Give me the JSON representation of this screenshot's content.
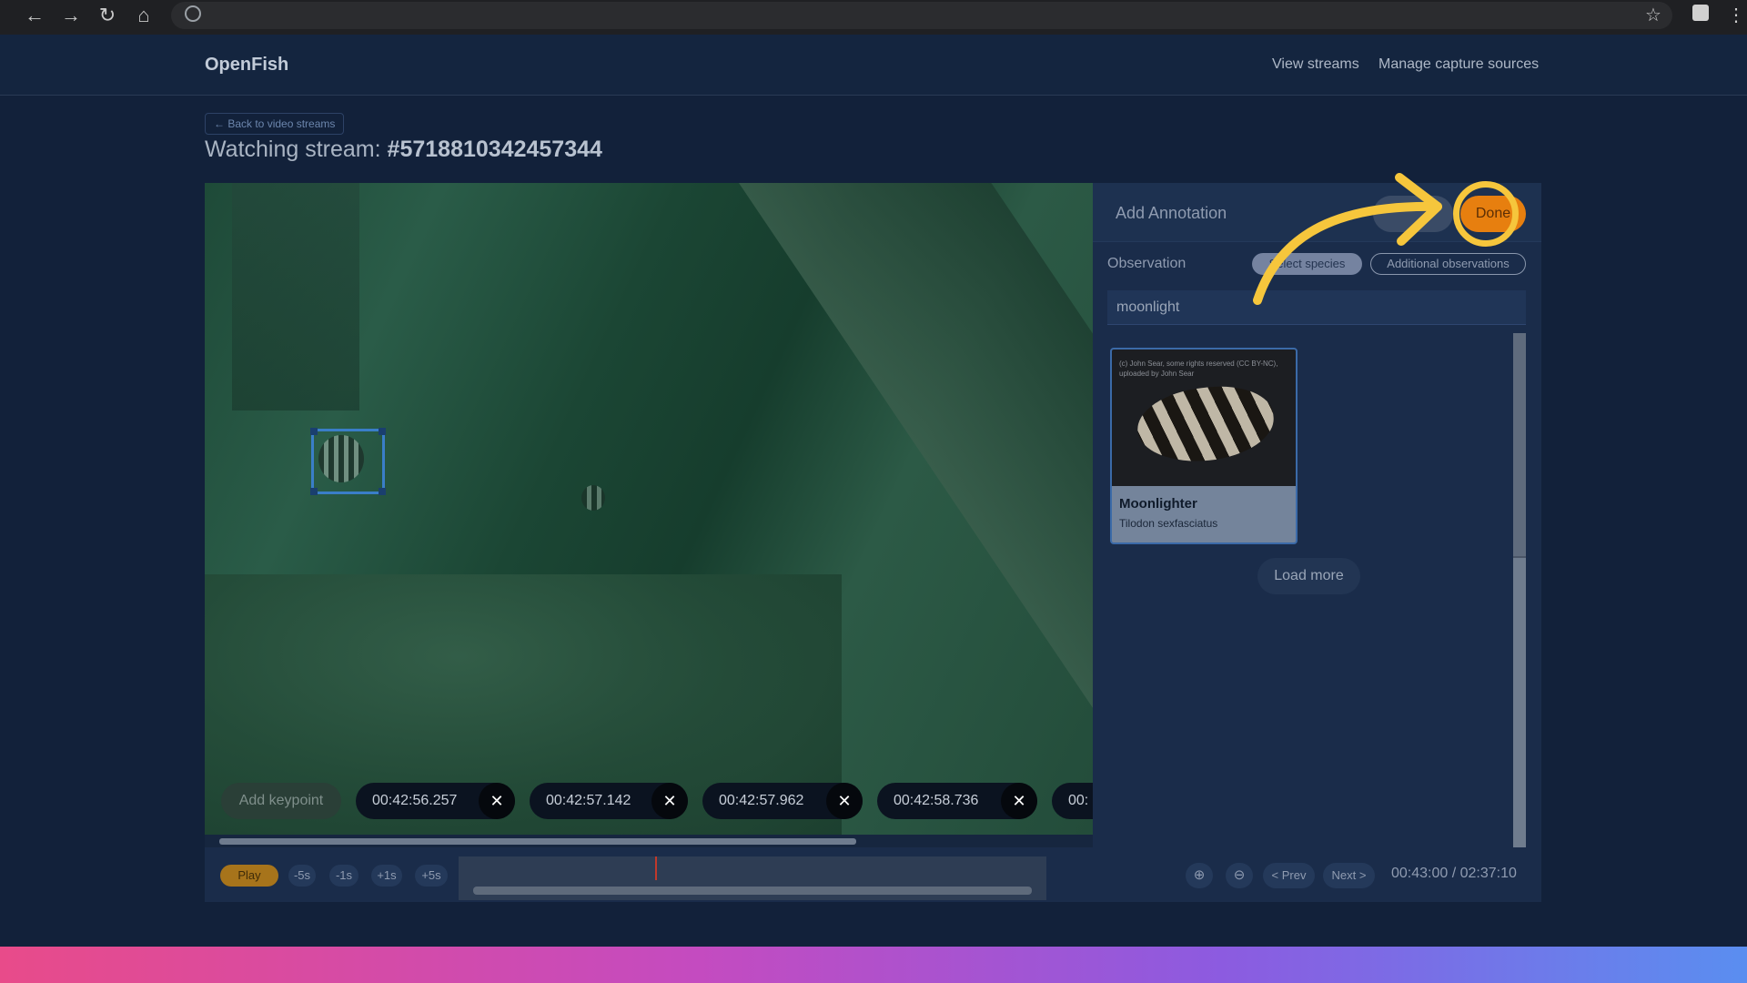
{
  "header": {
    "brand": "OpenFish",
    "nav": [
      "View streams",
      "Manage capture sources"
    ]
  },
  "page": {
    "back_label": "← Back to video streams",
    "title_prefix": "Watching stream:",
    "stream_id": "#5718810342457344"
  },
  "video": {
    "add_keypoint_label": "Add keypoint",
    "keypoints": [
      "00:42:56.257",
      "00:42:57.142",
      "00:42:57.962",
      "00:42:58.736",
      "00:"
    ],
    "remove_symbol": "✕"
  },
  "annotation": {
    "title": "Add Annotation",
    "done_label": "Done",
    "observation_label": "Observation",
    "chips": [
      "Select species",
      "Additional observations"
    ],
    "search_value": "moonlight",
    "results": [
      {
        "common_name": "Moonlighter",
        "scientific_name": "Tilodon sexfasciatus",
        "credit": "(c) John Sear, some rights reserved (CC BY-NC), uploaded by John Sear"
      }
    ],
    "load_more_label": "Load more"
  },
  "player": {
    "play_label": "Play",
    "step_buttons": [
      "-5s",
      "-1s",
      "+1s",
      "+5s"
    ],
    "prev_label": "< Prev",
    "next_label": "Next >",
    "timer": "00:43:00 / 02:37:10"
  },
  "browser": {
    "icons": [
      "back-arrow-icon",
      "forward-arrow-icon",
      "reload-icon",
      "home-icon",
      "globe-icon",
      "star-icon",
      "extensions-icon",
      "menu-icon"
    ]
  },
  "colors": {
    "accent_done": "#e77f0f",
    "highlight_ring": "#f6c63c",
    "bbox": "#3a7ec8"
  }
}
